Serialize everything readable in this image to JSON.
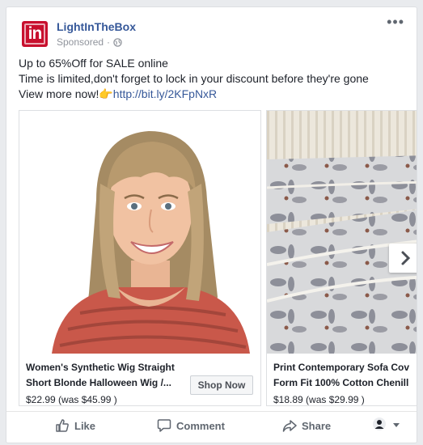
{
  "post": {
    "page_name": "LightInTheBox",
    "sponsored_label": "Sponsored",
    "logo_text": "in",
    "more_label": "•••",
    "body_line1": "Up to 65%Off for SALE online",
    "body_line2": "Time is limited,don't forget to lock in your discount before they're gone",
    "body_line3_text": "View more now!",
    "body_link": "http://bit.ly/2KFpNxR",
    "hand_emoji": "👉"
  },
  "carousel": {
    "items": [
      {
        "title_line1": "Women's Synthetic Wig Straight",
        "title_line2": "Short Blonde Halloween Wig /...",
        "price": "$22.99 (was $45.99 )",
        "cta": "Shop Now"
      },
      {
        "title_line1": "Print Contemporary Sofa Cov",
        "title_line2": "Form Fit 100% Cotton Chenill",
        "price": "$18.89 (was $29.99 )"
      }
    ]
  },
  "actions": {
    "like": "Like",
    "comment": "Comment",
    "share": "Share"
  },
  "colors": {
    "brand_red": "#c8102e",
    "link_blue": "#365899",
    "gray_text": "#606770"
  },
  "icons": [
    "globe-icon",
    "more-icon",
    "next-arrow-icon",
    "like-icon",
    "comment-icon",
    "share-icon",
    "audience-icon"
  ]
}
